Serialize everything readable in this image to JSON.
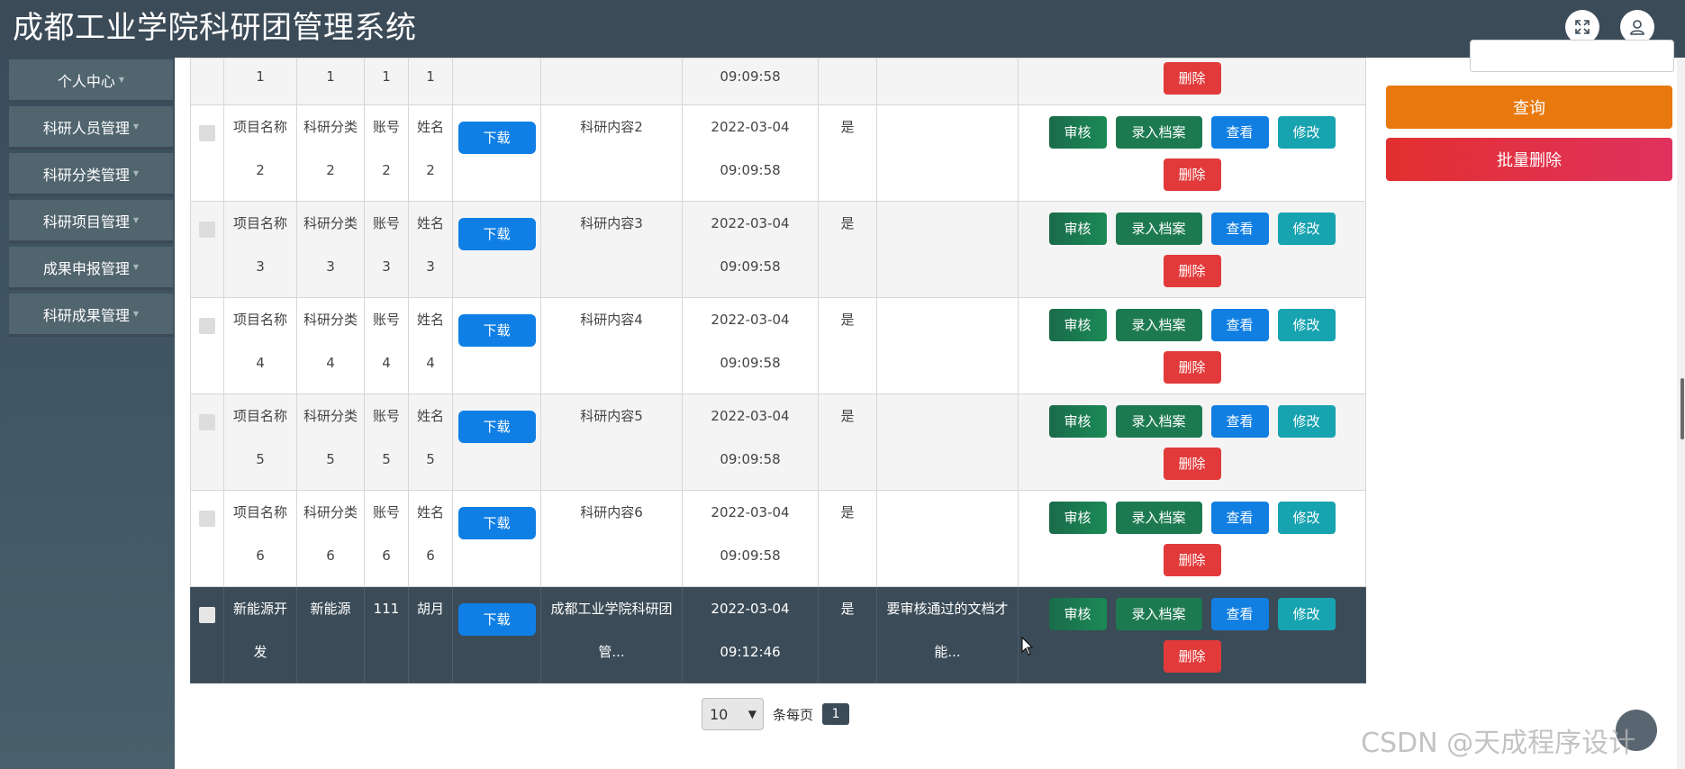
{
  "header": {
    "title": "成都工业学院科研团管理系统",
    "icons": [
      "fullscreen-icon",
      "user-icon"
    ]
  },
  "sidebar": {
    "items": [
      {
        "label": "个人中心"
      },
      {
        "label": "科研人员管理"
      },
      {
        "label": "科研分类管理"
      },
      {
        "label": "科研项目管理"
      },
      {
        "label": "成果申报管理"
      },
      {
        "label": "科研成果管理"
      }
    ]
  },
  "table": {
    "partial_row": {
      "c1": "1",
      "c2": "1",
      "c3": "1",
      "c4": "1",
      "time": "09:09:58"
    },
    "rows": [
      {
        "name_a": "项目名称",
        "name_b": "2",
        "cat_a": "科研分类",
        "cat_b": "2",
        "acct_a": "账号",
        "acct_b": "2",
        "person_a": "姓名",
        "person_b": "2",
        "content_a": "科研内容2",
        "content_b": "",
        "date": "2022-03-04",
        "time": "09:09:58",
        "flag": "是",
        "note_a": "",
        "note_b": ""
      },
      {
        "name_a": "项目名称",
        "name_b": "3",
        "cat_a": "科研分类",
        "cat_b": "3",
        "acct_a": "账号",
        "acct_b": "3",
        "person_a": "姓名",
        "person_b": "3",
        "content_a": "科研内容3",
        "content_b": "",
        "date": "2022-03-04",
        "time": "09:09:58",
        "flag": "是",
        "note_a": "",
        "note_b": ""
      },
      {
        "name_a": "项目名称",
        "name_b": "4",
        "cat_a": "科研分类",
        "cat_b": "4",
        "acct_a": "账号",
        "acct_b": "4",
        "person_a": "姓名",
        "person_b": "4",
        "content_a": "科研内容4",
        "content_b": "",
        "date": "2022-03-04",
        "time": "09:09:58",
        "flag": "是",
        "note_a": "",
        "note_b": ""
      },
      {
        "name_a": "项目名称",
        "name_b": "5",
        "cat_a": "科研分类",
        "cat_b": "5",
        "acct_a": "账号",
        "acct_b": "5",
        "person_a": "姓名",
        "person_b": "5",
        "content_a": "科研内容5",
        "content_b": "",
        "date": "2022-03-04",
        "time": "09:09:58",
        "flag": "是",
        "note_a": "",
        "note_b": ""
      },
      {
        "name_a": "项目名称",
        "name_b": "6",
        "cat_a": "科研分类",
        "cat_b": "6",
        "acct_a": "账号",
        "acct_b": "6",
        "person_a": "姓名",
        "person_b": "6",
        "content_a": "科研内容6",
        "content_b": "",
        "date": "2022-03-04",
        "time": "09:09:58",
        "flag": "是",
        "note_a": "",
        "note_b": ""
      },
      {
        "name_a": "新能源开",
        "name_b": "发",
        "cat_a": "新能源",
        "cat_b": "",
        "acct_a": "111",
        "acct_b": "",
        "person_a": "胡月",
        "person_b": "",
        "content_a": "成都工业学院科研团",
        "content_b": "管...",
        "date": "2022-03-04",
        "time": "09:12:46",
        "flag": "是",
        "note_a": "要审核通过的文档才",
        "note_b": "能..."
      }
    ],
    "buttons": {
      "download": "下载",
      "audit": "审核",
      "archive": "录入档案",
      "view": "查看",
      "edit": "修改",
      "delete": "删除"
    }
  },
  "right_panel": {
    "query": "查询",
    "batch_delete": "批量删除"
  },
  "pagination": {
    "page_size": "10",
    "per_page_label": "条每页",
    "current_page": "1"
  },
  "watermark": "CSDN @天成程序设计"
}
